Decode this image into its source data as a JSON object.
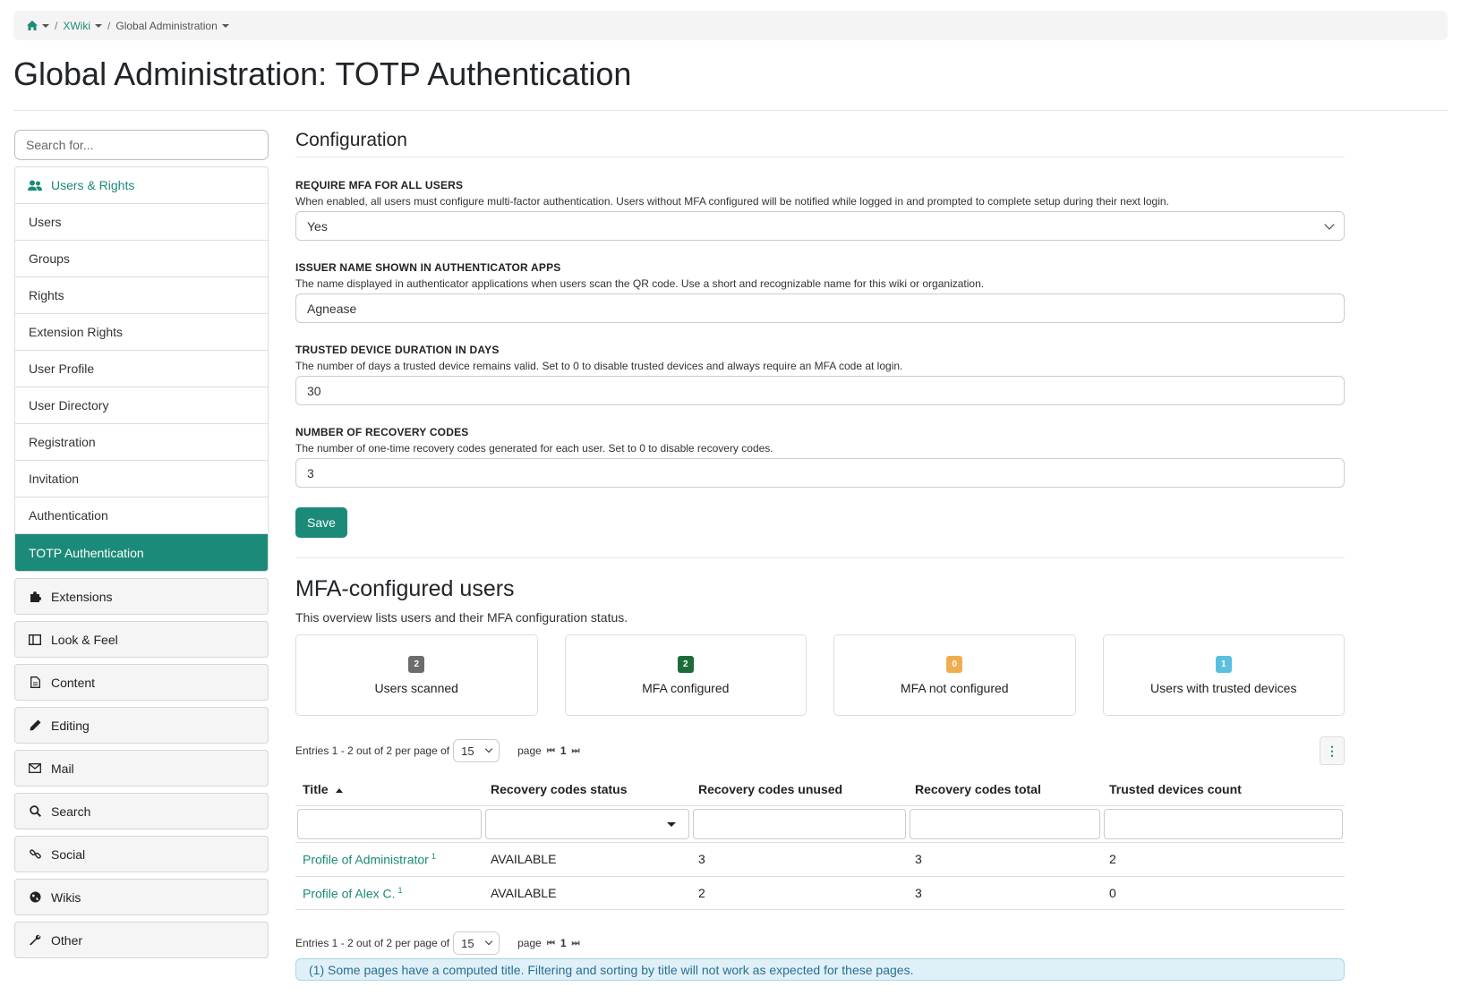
{
  "breadcrumb": {
    "wiki": "XWiki",
    "page": "Global Administration"
  },
  "page_title": "Global Administration: TOTP Authentication",
  "sidebar": {
    "search_placeholder": "Search for...",
    "group_title": "Users & Rights",
    "items": [
      "Users",
      "Groups",
      "Rights",
      "Extension Rights",
      "User Profile",
      "User Directory",
      "Registration",
      "Invitation",
      "Authentication",
      "TOTP Authentication"
    ],
    "categories": [
      {
        "label": "Extensions",
        "icon": "puzzle-icon"
      },
      {
        "label": "Look & Feel",
        "icon": "columns-icon"
      },
      {
        "label": "Content",
        "icon": "document-icon"
      },
      {
        "label": "Editing",
        "icon": "pencil-icon"
      },
      {
        "label": "Mail",
        "icon": "envelope-icon"
      },
      {
        "label": "Search",
        "icon": "search-icon"
      },
      {
        "label": "Social",
        "icon": "link-icon"
      },
      {
        "label": "Wikis",
        "icon": "globe-icon"
      },
      {
        "label": "Other",
        "icon": "wrench-icon"
      }
    ]
  },
  "config": {
    "heading": "Configuration",
    "require_mfa": {
      "label": "REQUIRE MFA FOR ALL USERS",
      "hint": "When enabled, all users must configure multi-factor authentication. Users without MFA configured will be notified while logged in and prompted to complete setup during their next login.",
      "value": "Yes"
    },
    "issuer": {
      "label": "ISSUER NAME SHOWN IN AUTHENTICATOR APPS",
      "hint": "The name displayed in authenticator applications when users scan the QR code. Use a short and recognizable name for this wiki or organization.",
      "value": "Agnease"
    },
    "trusted_days": {
      "label": "TRUSTED DEVICE DURATION IN DAYS",
      "hint": "The number of days a trusted device remains valid. Set to 0 to disable trusted devices and always require an MFA code at login.",
      "value": "30"
    },
    "recovery_codes": {
      "label": "NUMBER OF RECOVERY CODES",
      "hint": "The number of one-time recovery codes generated for each user. Set to 0 to disable recovery codes.",
      "value": "3"
    },
    "save_label": "Save"
  },
  "mfa": {
    "heading": "MFA-configured users",
    "description": "This overview lists users and their MFA configuration status.",
    "cards": [
      {
        "count": "2",
        "label": "Users scanned",
        "color": "#6c6c6c"
      },
      {
        "count": "2",
        "label": "MFA configured",
        "color": "#1e6b3a"
      },
      {
        "count": "0",
        "label": "MFA not configured",
        "color": "#f0ad4e"
      },
      {
        "count": "1",
        "label": "Users with trusted devices",
        "color": "#5bc0de"
      }
    ],
    "pager": {
      "entries_text": "Entries 1 - 2 out of 2 per page of",
      "per_page": "15",
      "page_label": "page",
      "current_page": "1"
    },
    "columns": [
      "Title",
      "Recovery codes status",
      "Recovery codes unused",
      "Recovery codes total",
      "Trusted devices count"
    ],
    "rows": [
      {
        "title": "Profile of Administrator",
        "sup": "1",
        "status": "AVAILABLE",
        "unused": "3",
        "total": "3",
        "trusted": "2"
      },
      {
        "title": "Profile of Alex C.",
        "sup": "1",
        "status": "AVAILABLE",
        "unused": "2",
        "total": "3",
        "trusted": "0"
      }
    ],
    "note": "(1) Some pages have a computed title. Filtering and sorting by title will not work as expected for these pages."
  }
}
